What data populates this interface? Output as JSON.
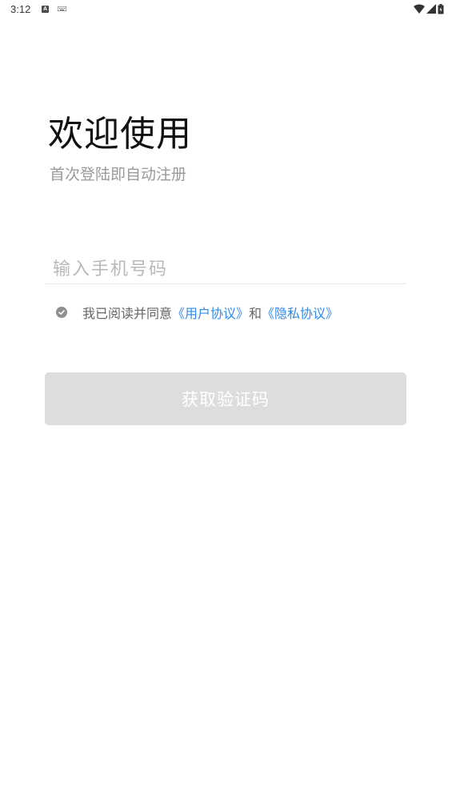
{
  "status_bar": {
    "time": "3:12",
    "notification_icon_letter": "A",
    "icons": [
      "a-notification-icon",
      "keyboard-icon",
      "wifi-icon",
      "signal-icon",
      "battery-icon"
    ]
  },
  "header": {
    "title": "欢迎使用",
    "subtitle": "首次登陆即自动注册"
  },
  "phone": {
    "placeholder": "输入手机号码",
    "value": ""
  },
  "agreement": {
    "checked": true,
    "prefix": "我已阅读并同意",
    "user_agreement_link": "《用户协议》",
    "conjunction": "和",
    "privacy_policy_link": "《隐私协议》"
  },
  "actions": {
    "get_code_label": "获取验证码"
  },
  "colors": {
    "link": "#2f8ae8",
    "button_disabled_bg": "#dcdddf",
    "subtitle": "#9a9a9a"
  }
}
